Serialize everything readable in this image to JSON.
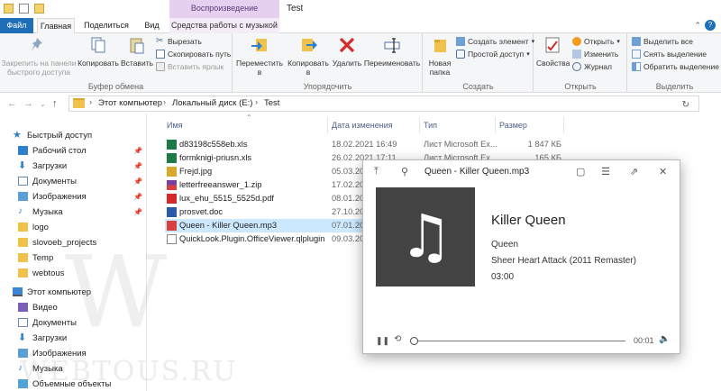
{
  "window": {
    "title": "Test",
    "context_tab": "Воспроизведение"
  },
  "tabs": {
    "file": "Файл",
    "home": "Главная",
    "share": "Поделиться",
    "view": "Вид",
    "music": "Средства работы с музыкой"
  },
  "ribbon": {
    "clipboard": {
      "pin": "Закрепить на панели быстрого доступа",
      "pin_l1": "Закрепить на панели",
      "pin_l2": "быстрого доступа",
      "copy": "Копировать",
      "paste": "Вставить",
      "cut": "Вырезать",
      "copy_path": "Скопировать путь",
      "paste_shortcut": "Вставить ярлык",
      "label": "Буфер обмена"
    },
    "organize": {
      "move_to": "Переместить в",
      "move_l1": "Переместить",
      "move_l2": "в",
      "copy_to": "Копировать в",
      "copy_l1": "Копировать",
      "copy_l2": "в",
      "delete": "Удалить",
      "rename": "Переименовать",
      "label": "Упорядочить"
    },
    "new": {
      "new_folder_l1": "Новая",
      "new_folder_l2": "папка",
      "new_item": "Создать элемент",
      "easy_access": "Простой доступ",
      "label": "Создать"
    },
    "open": {
      "properties": "Свойства",
      "open": "Открыть",
      "edit": "Изменить",
      "history": "Журнал",
      "label": "Открыть"
    },
    "select": {
      "select_all": "Выделить все",
      "select_none": "Снять выделение",
      "invert": "Обратить выделение",
      "label": "Выделить"
    }
  },
  "address": {
    "crumbs": [
      "Этот компьютер",
      "Локальный диск (E:)",
      "Test"
    ]
  },
  "nav_pane": {
    "quick_access": "Быстрый доступ",
    "pinned": [
      "Рабочий стол",
      "Загрузки",
      "Документы",
      "Изображения",
      "Музыка"
    ],
    "folders": [
      "logo",
      "slovoeb_projects",
      "Temp",
      "webtous"
    ],
    "this_pc": "Этот компьютер",
    "pc_items": [
      "Видео",
      "Документы",
      "Загрузки",
      "Изображения",
      "Музыка",
      "Объемные объекты"
    ]
  },
  "columns": {
    "name": "Имя",
    "date": "Дата изменения",
    "type": "Тип",
    "size": "Размер"
  },
  "files": [
    {
      "name": "d83198c558eb.xls",
      "date": "18.02.2021 16:49",
      "type": "Лист Microsoft Ex...",
      "size": "1 847 КБ",
      "icon": "excel-icon"
    },
    {
      "name": "formknigi-priusn.xls",
      "date": "26.02.2021 17:11",
      "type": "Лист Microsoft Ex...",
      "size": "165 КБ",
      "icon": "excel-icon"
    },
    {
      "name": "Frejd.jpg",
      "date": "05.03.202",
      "type": "",
      "size": "",
      "icon": "image-icon"
    },
    {
      "name": "letterfreeanswer_1.zip",
      "date": "17.02.202",
      "type": "",
      "size": "",
      "icon": "zip-icon"
    },
    {
      "name": "lux_ehu_5515_5525d.pdf",
      "date": "08.01.201",
      "type": "",
      "size": "",
      "icon": "pdf-icon"
    },
    {
      "name": "prosvet.doc",
      "date": "27.10.201",
      "type": "",
      "size": "",
      "icon": "word-icon"
    },
    {
      "name": "Queen - Killer Queen.mp3",
      "date": "07.01.201",
      "type": "",
      "size": "",
      "icon": "mp3-icon"
    },
    {
      "name": "QuickLook.Plugin.OfficeViewer.qlplugin",
      "date": "09.03.202",
      "type": "",
      "size": "",
      "icon": "file-icon"
    }
  ],
  "quicklook": {
    "title": "Queen - Killer Queen.mp3",
    "song": "Killer Queen",
    "artist": "Queen",
    "album": "Sheer Heart Attack (2011 Remaster)",
    "duration": "03:00",
    "elapsed": "00:01"
  },
  "watermark": {
    "letter": "W",
    "text": "WEBTOUS.RU"
  }
}
